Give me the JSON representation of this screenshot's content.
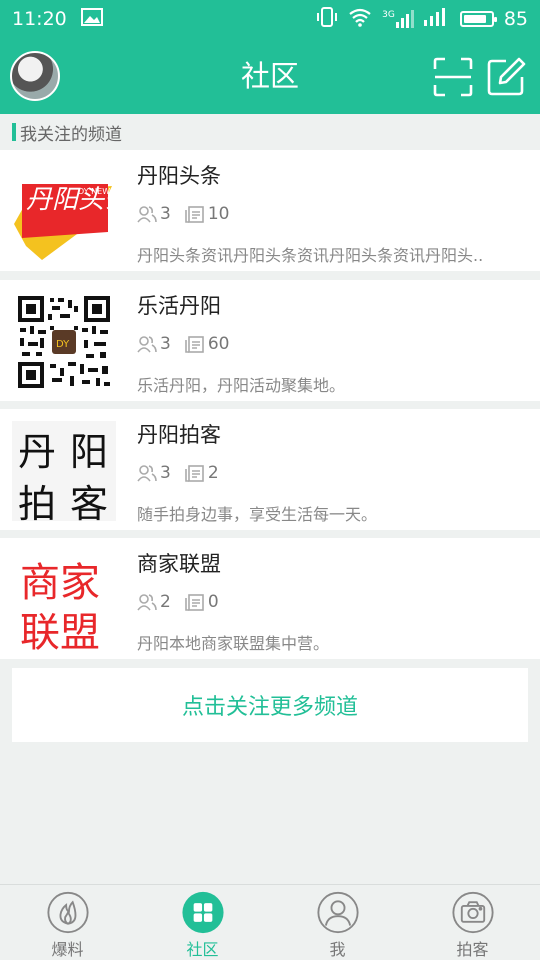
{
  "status": {
    "time": "11:20",
    "network": "3G",
    "battery": "85",
    "battery_level": 0.85
  },
  "header": {
    "title": "社区"
  },
  "section": {
    "label": "我关注的频道"
  },
  "channels": [
    {
      "name": "丹阳头条",
      "members": "3",
      "posts": "10",
      "desc": "丹阳头条资讯丹阳头条资讯丹阳头条资讯丹阳头..",
      "thumb_icon": "danyang-toutiao-logo",
      "logo_text": "丹阳头条",
      "logo_sub": "DY NEWS"
    },
    {
      "name": "乐活丹阳",
      "members": "3",
      "posts": "60",
      "desc": "乐活丹阳，丹阳活动聚集地。",
      "thumb_icon": "qr-code-image",
      "logo_text": "DY"
    },
    {
      "name": "丹阳拍客",
      "members": "3",
      "posts": "2",
      "desc": "随手拍身边事，享受生活每一天。",
      "thumb_icon": "danyang-paike-logo",
      "logo_text": [
        "丹",
        "阳",
        "拍",
        "客"
      ]
    },
    {
      "name": "商家联盟",
      "members": "2",
      "posts": "0",
      "desc": "丹阳本地商家联盟集中营。",
      "thumb_icon": "merchant-alliance-logo",
      "logo_text": [
        "商家",
        "联盟"
      ]
    }
  ],
  "more_button": {
    "label": "点击关注更多频道"
  },
  "nav": {
    "items": [
      {
        "label": "爆料",
        "icon": "flame-icon",
        "active": false
      },
      {
        "label": "社区",
        "icon": "grid-icon",
        "active": true
      },
      {
        "label": "我",
        "icon": "person-icon",
        "active": false
      },
      {
        "label": "拍客",
        "icon": "camera-icon",
        "active": false
      }
    ]
  },
  "colors": {
    "accent": "#22bf97",
    "logo_red": "#e8272a",
    "logo_yellow": "#f4c21f"
  }
}
